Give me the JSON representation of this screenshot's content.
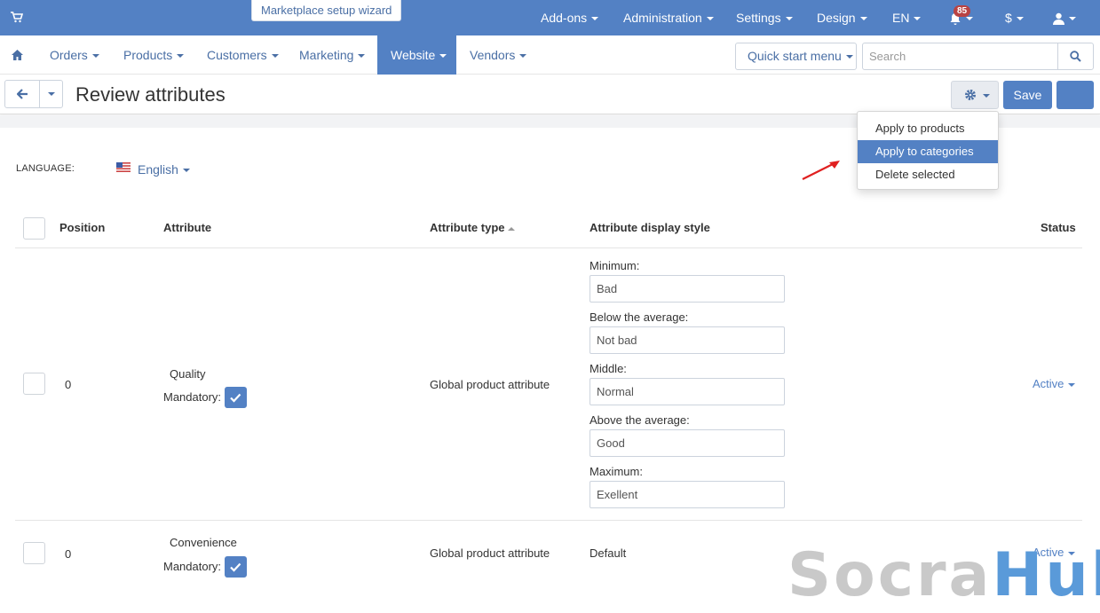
{
  "topbar": {
    "wizard_label": "Marketplace setup wizard",
    "menu": [
      "Add-ons",
      "Administration",
      "Settings",
      "Design",
      "EN"
    ],
    "notification_count": "85",
    "currency": "$"
  },
  "nav": {
    "items": [
      "Orders",
      "Products",
      "Customers",
      "Marketing",
      "Website",
      "Vendors"
    ],
    "active": "Website",
    "quick_start": "Quick start menu",
    "search_placeholder": "Search"
  },
  "header": {
    "title": "Review attributes",
    "save_label": "Save"
  },
  "dropdown": {
    "items": [
      "Apply to products",
      "Apply to categories",
      "Delete selected"
    ],
    "active_index": 1
  },
  "language": {
    "label": "LANGUAGE:",
    "value": "English"
  },
  "table": {
    "columns": [
      "Position",
      "Attribute",
      "Attribute type",
      "Attribute display style",
      "Status"
    ],
    "rows": [
      {
        "position": "0",
        "attribute": "Quality",
        "mandatory_label": "Mandatory:",
        "mandatory": true,
        "type": "Global product attribute",
        "display": {
          "levels": [
            {
              "label": "Minimum:",
              "value": "Bad"
            },
            {
              "label": "Below the average:",
              "value": "Not bad"
            },
            {
              "label": "Middle:",
              "value": "Normal"
            },
            {
              "label": "Above the average:",
              "value": "Good"
            },
            {
              "label": "Maximum:",
              "value": "Exellent"
            }
          ]
        },
        "status": "Active"
      },
      {
        "position": "0",
        "attribute": "Convenience",
        "mandatory_label": "Mandatory:",
        "mandatory": true,
        "type": "Global product attribute",
        "display_text": "Default",
        "status": "Active"
      }
    ]
  },
  "watermark": {
    "part1": "Socra",
    "part2": "Hub"
  },
  "colors": {
    "brand": "#5381c4",
    "link": "#4a6fa5",
    "arrow": "#e02020"
  }
}
